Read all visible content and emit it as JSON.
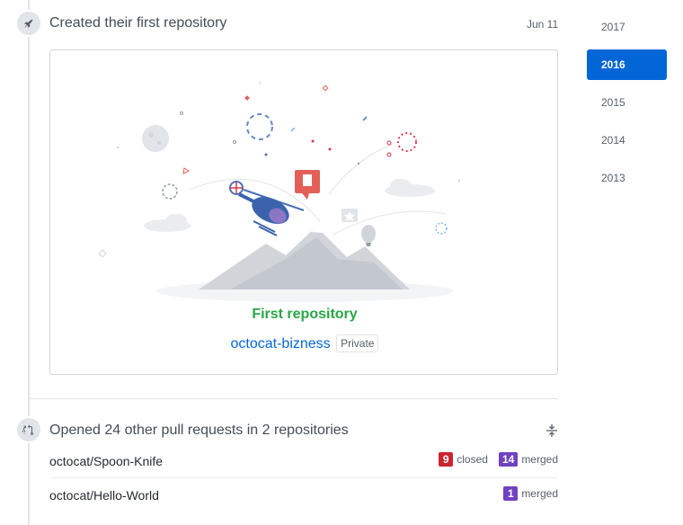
{
  "events": {
    "first_repo": {
      "icon": "rocket-icon",
      "title": "Created their first repository",
      "date": "Jun 11",
      "card": {
        "heading": "First repository",
        "repo_name": "octocat-bizness",
        "visibility": "Private"
      }
    },
    "pull_requests": {
      "icon": "git-pull-request-icon",
      "title": "Opened 24 other pull requests in 2 repositories",
      "collapse_icon": "fold-icon",
      "rows": [
        {
          "repo": "octocat/Spoon-Knife",
          "closed_count": "9",
          "closed_label": "closed",
          "merged_count": "14",
          "merged_label": "merged"
        },
        {
          "repo": "octocat/Hello-World",
          "merged_count": "1",
          "merged_label": "merged"
        }
      ]
    }
  },
  "year_nav": {
    "selected": "2016",
    "years": [
      "2017",
      "2016",
      "2015",
      "2014",
      "2013"
    ]
  },
  "colors": {
    "link": "#0366d6",
    "success": "#28a745",
    "closed": "#cb2431",
    "merged": "#6f42c1"
  }
}
